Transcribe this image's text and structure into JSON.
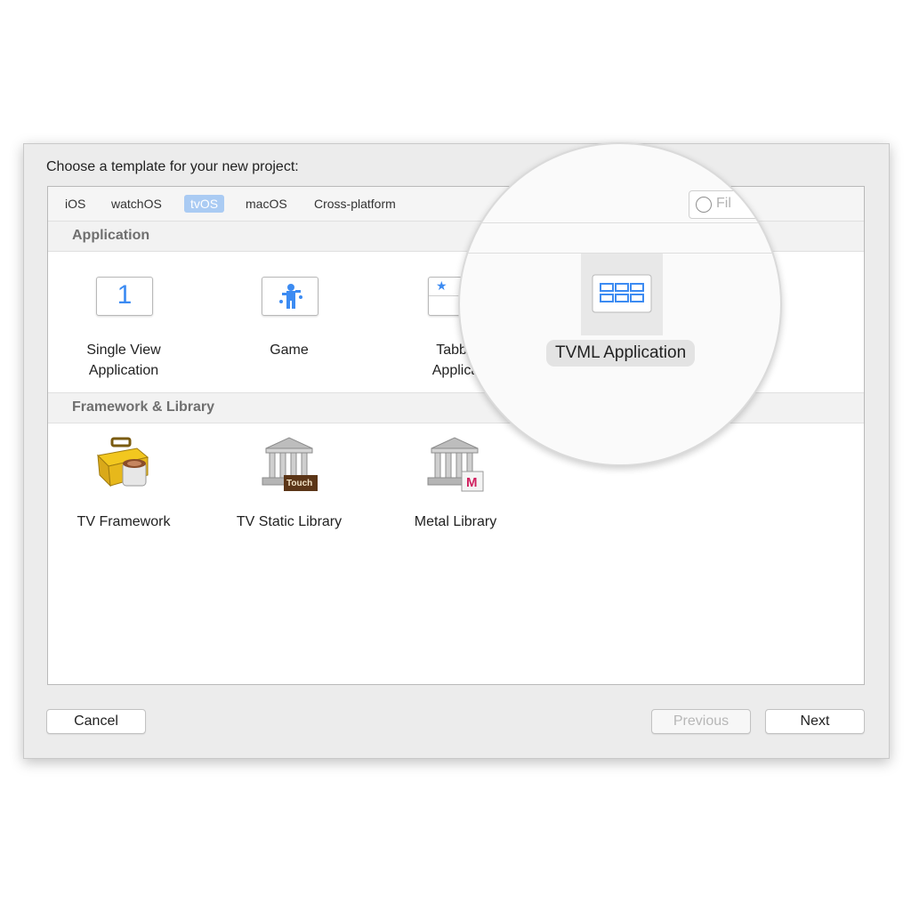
{
  "dialog": {
    "title": "Choose a template for your new project:"
  },
  "tabs": [
    {
      "label": "iOS",
      "active": false
    },
    {
      "label": "watchOS",
      "active": false
    },
    {
      "label": "tvOS",
      "active": true
    },
    {
      "label": "macOS",
      "active": false
    },
    {
      "label": "Cross-platform",
      "active": false
    }
  ],
  "search": {
    "placeholder": "Filter",
    "visible_text": "Fil"
  },
  "sections": {
    "application": {
      "header": "Application",
      "items": [
        {
          "label_line1": "Single View",
          "label_line2": "Application",
          "icon": "single-view-icon",
          "glyph": "1"
        },
        {
          "label_line1": "Game",
          "label_line2": "",
          "icon": "game-icon"
        },
        {
          "label_line1": "Tabbe",
          "label_line2": "Applica",
          "icon": "tabbed-icon",
          "glyph": "★"
        },
        {
          "label_line1": "TVML Application",
          "label_line2": "",
          "icon": "tvml-icon"
        }
      ]
    },
    "framework": {
      "header": "Framework & Library",
      "items": [
        {
          "label": "TV Framework",
          "icon": "toolbox-icon"
        },
        {
          "label": "TV Static Library",
          "icon": "library-building-icon",
          "badge": "Touch"
        },
        {
          "label": "Metal Library",
          "icon": "metal-library-icon",
          "badge": "M"
        }
      ]
    }
  },
  "buttons": {
    "cancel": "Cancel",
    "previous": "Previous",
    "next": "Next"
  },
  "colors": {
    "accent": "#3c8bf2",
    "tab_active": "#aacbf3"
  }
}
